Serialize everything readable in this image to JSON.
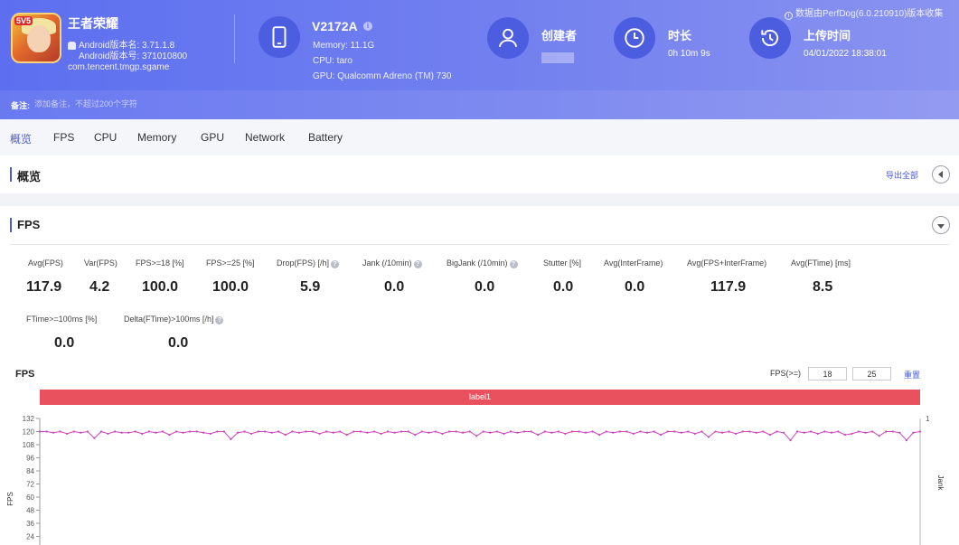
{
  "app": {
    "name": "王者荣耀",
    "version_name": "Android版本名: 3.71.1.8",
    "version_code": "Android版本号: 371010800",
    "package": "com.tencent.tmgp.sgame",
    "icon_badge": "5V5"
  },
  "device": {
    "name": "V2172A",
    "memory": "Memory: 11.1G",
    "cpu": "CPU: taro",
    "gpu": "GPU: Qualcomm Adreno (TM) 730"
  },
  "meta": {
    "creator_label": "创建者",
    "duration_label": "时长",
    "duration_value": "0h 10m 9s",
    "upload_label": "上传时间",
    "upload_value": "04/01/2022 18:38:01",
    "version_note": "数据由PerfDog(6.0.210910)版本收集"
  },
  "remark": {
    "label": "备注:",
    "placeholder": "添加备注，不超过200个字符"
  },
  "tabs": [
    "概览",
    "FPS",
    "CPU",
    "Memory",
    "GPU",
    "Network",
    "Battery"
  ],
  "overview": {
    "title": "概览",
    "export_label": "导出全部"
  },
  "fps_section": {
    "title": "FPS",
    "stats": [
      {
        "label": "Avg(FPS)",
        "value": "117.9"
      },
      {
        "label": "Var(FPS)",
        "value": "4.2"
      },
      {
        "label": "FPS>=18 [%]",
        "value": "100.0"
      },
      {
        "label": "FPS>=25 [%]",
        "value": "100.0"
      },
      {
        "label": "Drop(FPS) [/h]",
        "value": "5.9"
      },
      {
        "label": "Jank (/10min)",
        "value": "0.0"
      },
      {
        "label": "BigJank (/10min)",
        "value": "0.0"
      },
      {
        "label": "Stutter [%]",
        "value": "0.0"
      },
      {
        "label": "Avg(InterFrame)",
        "value": "0.0"
      },
      {
        "label": "Avg(FPS+InterFrame)",
        "value": "117.9"
      },
      {
        "label": "Avg(FTime) [ms]",
        "value": "8.5"
      },
      {
        "label": "FTime>=100ms [%]",
        "value": "0.0"
      },
      {
        "label": "Delta(FTime)>100ms [/h]",
        "value": "0.0"
      }
    ]
  },
  "chart": {
    "title": "FPS",
    "threshold_label": "FPS(>=)",
    "threshold_low": "18",
    "threshold_high": "25",
    "reset_label": "重置",
    "label_bar": "label1"
  },
  "colors": {
    "accent": "#4a5bd8",
    "banner_start": "#5d6ff0",
    "label_bar": "#e9515f",
    "fps_line": "#cc44b8"
  },
  "chart_data": {
    "type": "line",
    "title": "",
    "xlabel": "",
    "ylabel": "FPS",
    "y2label": "Jank",
    "ylim": [
      24,
      132
    ],
    "yticks": [
      24,
      36,
      48,
      60,
      72,
      84,
      96,
      108,
      120,
      132
    ],
    "y2ticks": [
      1
    ],
    "series": [
      {
        "name": "FPS",
        "values": [
          120,
          120,
          119,
          120,
          118,
          120,
          119,
          120,
          114,
          120,
          118,
          120,
          119,
          119,
          120,
          118,
          120,
          119,
          120,
          117,
          120,
          119,
          120,
          120,
          119,
          118,
          120,
          120,
          113,
          119,
          120,
          118,
          120,
          120,
          119,
          120,
          117,
          120,
          119,
          120,
          120,
          118,
          120,
          119,
          120,
          117,
          120,
          120,
          119,
          120,
          118,
          120,
          119,
          120,
          120,
          117,
          120,
          119,
          120,
          118,
          120,
          120,
          119,
          120,
          116,
          120,
          119,
          120,
          118,
          120,
          119,
          120,
          120,
          117,
          120,
          119,
          120,
          118,
          120,
          120,
          119,
          120,
          117,
          120,
          119,
          120,
          120,
          118,
          120,
          119,
          120,
          117,
          120,
          120,
          119,
          120,
          118,
          120,
          115,
          120,
          119,
          120,
          118,
          120,
          120,
          119,
          120,
          117,
          120,
          119,
          112,
          120,
          119,
          120,
          118,
          120,
          119,
          120,
          117,
          118,
          120,
          119,
          120,
          116,
          120,
          120,
          119,
          112,
          119,
          120
        ]
      }
    ]
  }
}
